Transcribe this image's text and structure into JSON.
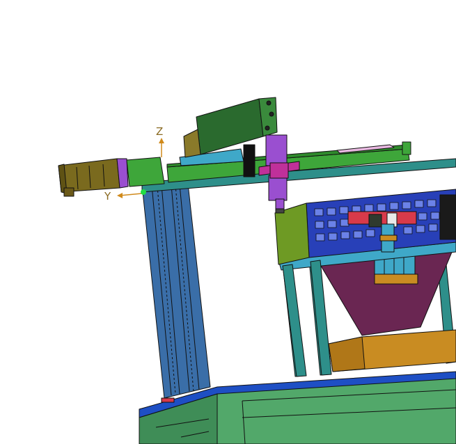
{
  "viewport": {
    "background": "#ffffff",
    "triad": {
      "z_label": "Z",
      "y_label": "Y",
      "axis_color": "#d08a1c",
      "origin_color": "#22dd44"
    }
  },
  "palette": {
    "frame_teal": "#2e8f8a",
    "table_green": "#52a86a",
    "table_top_blue": "#1e4fc4",
    "column_blue": "#3a6ea8",
    "gantry_green": "#3ea63a",
    "motor_olive": "#7a6a1e",
    "carriage_dark": "#2a6a2e",
    "slider_cyan": "#3fa8c8",
    "z_axis_purple": "#9a4fd0",
    "gripper_magenta": "#c0309a",
    "basket_blue": "#2840b8",
    "hopper_plum": "#6a2652",
    "bin_gold": "#c98c22",
    "bracket_red": "#d83a4a",
    "panel_olive": "#6e9a24"
  }
}
